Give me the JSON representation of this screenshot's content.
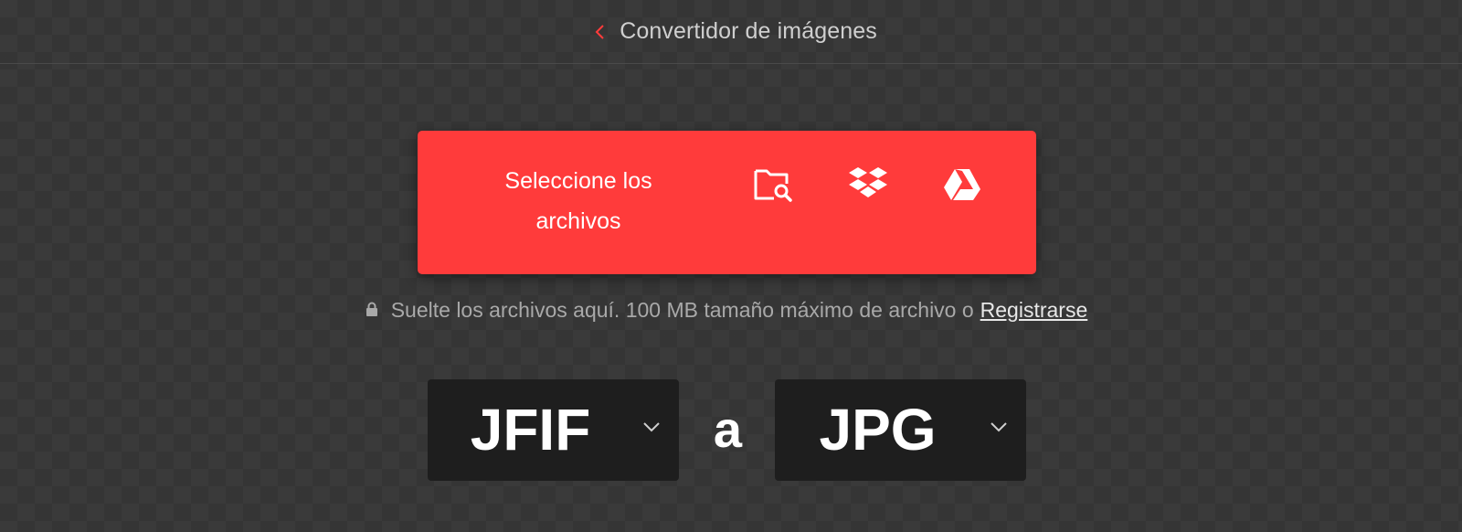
{
  "header": {
    "back_icon": "chevron-left-icon",
    "title": "Convertidor de imágenes"
  },
  "upload": {
    "select_label": "Seleccione los archivos",
    "icons": [
      "folder-search-icon",
      "dropbox-icon",
      "google-drive-icon"
    ]
  },
  "hint": {
    "icon": "lock-icon",
    "text": "Suelte los archivos aquí. 100 MB tamaño máximo de archivo o",
    "register_label": "Registrarse"
  },
  "converter": {
    "from_format": "JFIF",
    "connector": "a",
    "to_format": "JPG"
  },
  "colors": {
    "accent": "#ff3b3b",
    "background": "#3a3a3a",
    "select_bg": "#1e1e1e"
  }
}
